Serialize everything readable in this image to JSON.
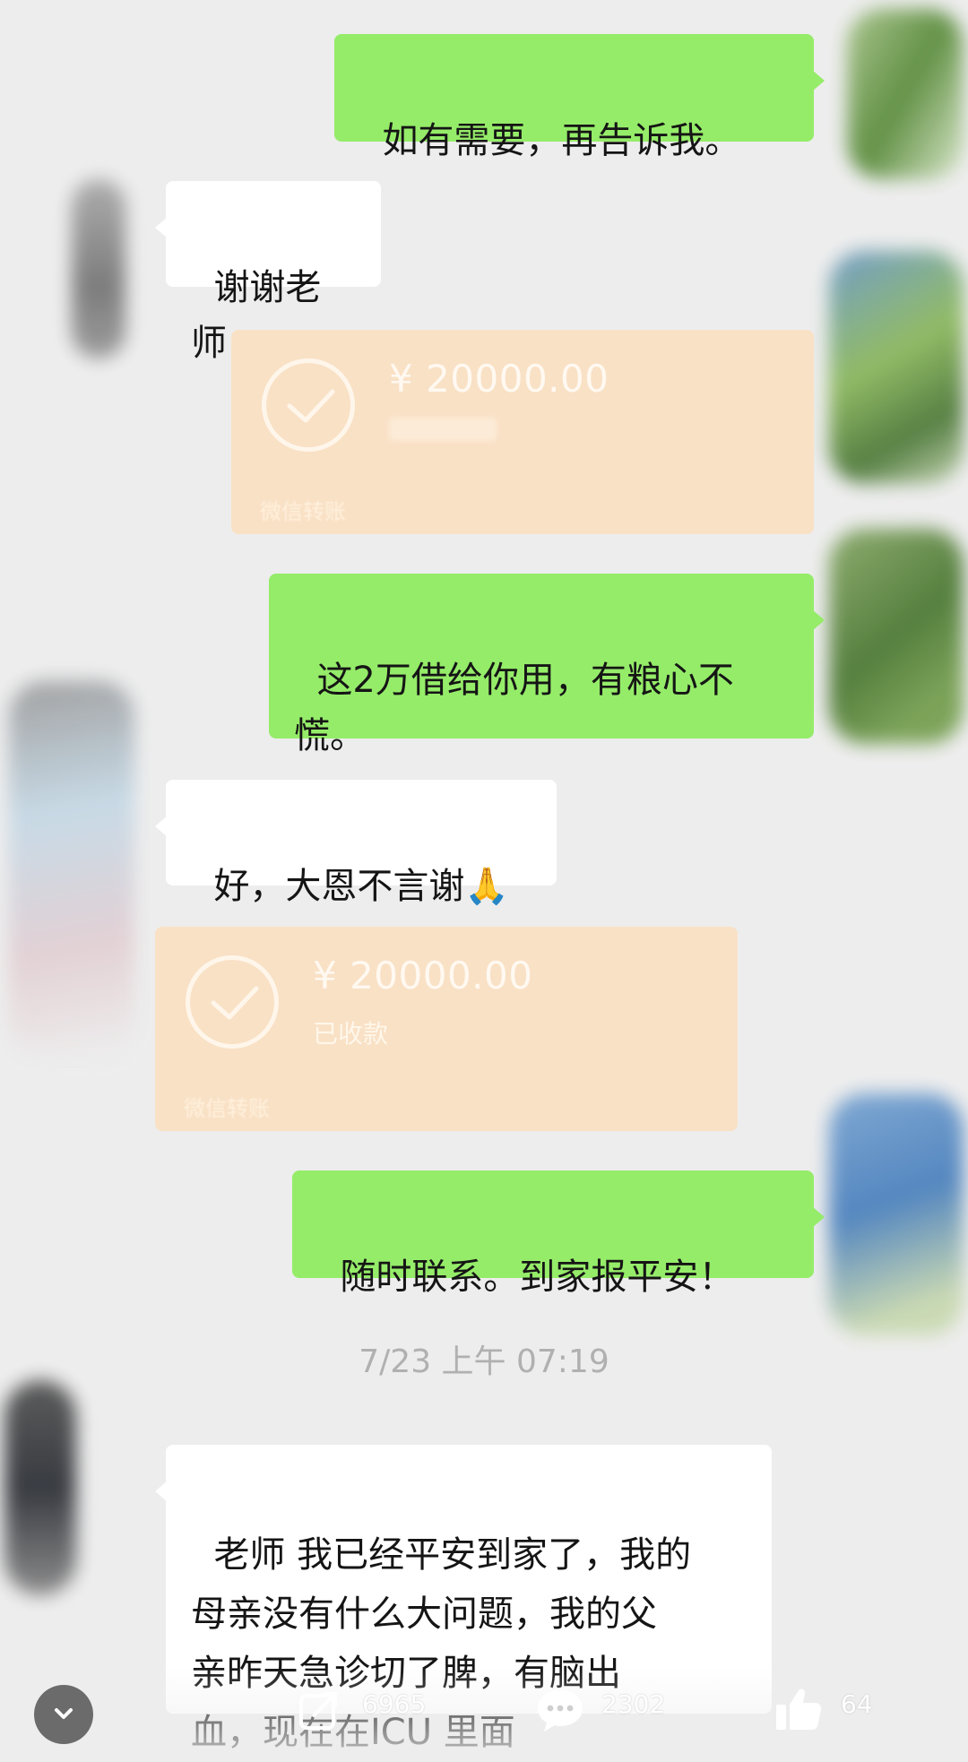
{
  "messages": {
    "m1": "如有需要，再告诉我。",
    "m2": "谢谢老师",
    "m4": "这2万借给你用，有粮心不\n慌。",
    "m5": "好，大恩不言谢🙏",
    "m7": "随时联系。到家报平安！",
    "m8": "老师 我已经平安到家了，我的\n母亲没有什么大问题，我的父\n亲昨天急诊切了脾，有脑出\n血，现在在ICU 里面"
  },
  "transfers": [
    {
      "amount": "¥ 20000.00",
      "status": "",
      "label": "微信转账"
    },
    {
      "amount": "¥ 20000.00",
      "status": "已收款",
      "label": "微信转账"
    }
  ],
  "timestamp": "7/23 上午 07:19",
  "stats": {
    "share_count": "6965",
    "comment_count": "2302",
    "like_count": "64"
  },
  "colors": {
    "outgoing_bubble": "#95ec69",
    "incoming_bubble": "#ffffff",
    "transfer_card": "#f9e1c6",
    "background": "#ededed"
  },
  "icons": [
    "check-circle-icon",
    "chevron-down-icon",
    "share-icon",
    "comment-icon",
    "like-icon"
  ]
}
